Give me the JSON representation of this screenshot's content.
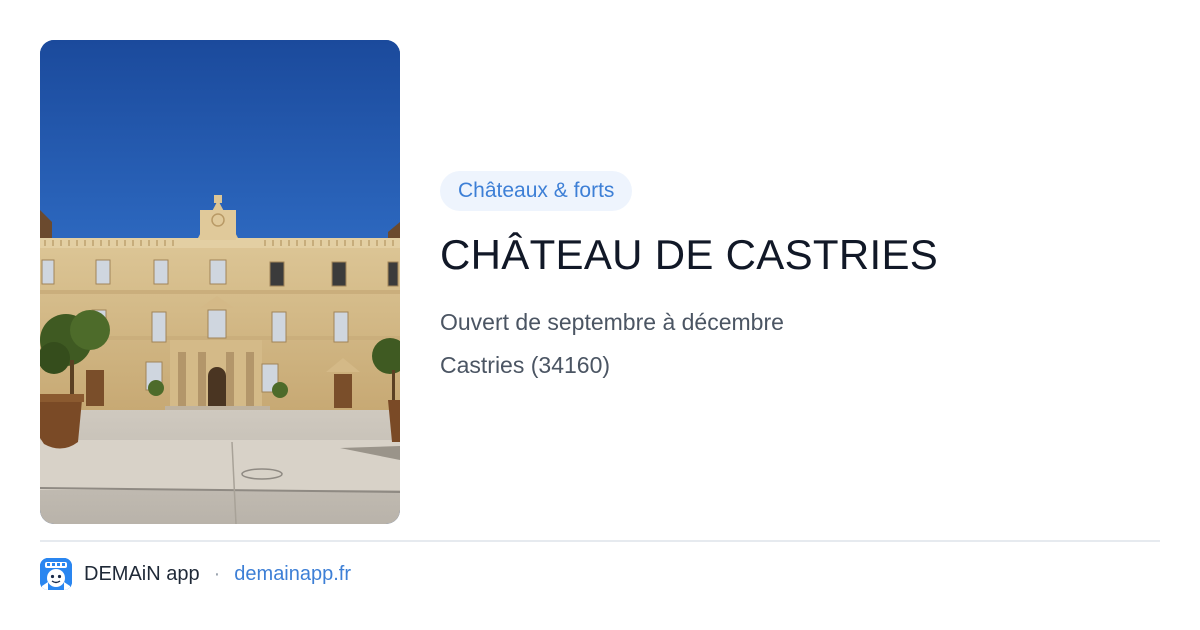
{
  "card": {
    "photo_alt": "Château de Castries",
    "category": "Châteaux & forts",
    "title": "CHÂTEAU DE CASTRIES",
    "opening": "Ouvert de septembre à décembre",
    "location": "Castries (34160)"
  },
  "footer": {
    "app_name": "DEMAiN app",
    "separator": "·",
    "site": "demainapp.fr",
    "app_icon": "demain-app-icon"
  },
  "colors": {
    "accent": "#3d7fd6",
    "badge_bg": "#eef4fd",
    "title": "#111827",
    "muted": "#4b5563",
    "divider": "#e6eaef"
  }
}
